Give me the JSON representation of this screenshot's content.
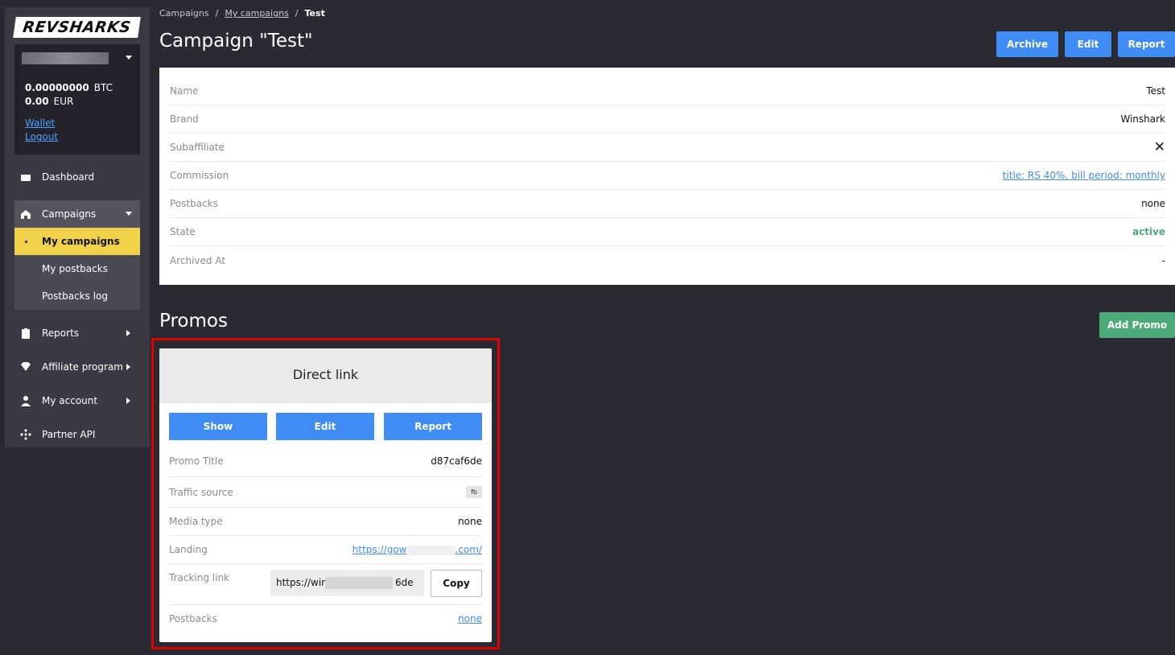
{
  "brand": {
    "logo_text": "REVSHARKS"
  },
  "balance": {
    "btc_amount": "0.00000000",
    "btc_currency": "BTC",
    "eur_amount": "0.00",
    "eur_currency": "EUR",
    "wallet_label": "Wallet",
    "logout_label": "Logout"
  },
  "sidebar": {
    "dashboard": "Dashboard",
    "campaigns": "Campaigns",
    "my_campaigns": "My campaigns",
    "my_postbacks": "My postbacks",
    "postbacks_log": "Postbacks log",
    "reports": "Reports",
    "affiliate_program": "Affiliate program",
    "my_account": "My account",
    "partner_api": "Partner API"
  },
  "breadcrumb": {
    "root": "Campaigns",
    "mid": "My campaigns",
    "sep": "/",
    "current": "Test"
  },
  "page_title": "Campaign \"Test\"",
  "header_buttons": {
    "archive": "Archive",
    "edit": "Edit",
    "report": "Report"
  },
  "campaign": {
    "rows": [
      {
        "label": "Name",
        "value": "Test"
      },
      {
        "label": "Brand",
        "value": "Winshark"
      },
      {
        "label": "Subaffiliate",
        "value": "✕"
      },
      {
        "label": "Commission",
        "value": "title: RS 40%, bill period: monthly"
      },
      {
        "label": "Postbacks",
        "value": "none"
      },
      {
        "label": "State",
        "value": "active"
      },
      {
        "label": "Archived At",
        "value": "-"
      }
    ]
  },
  "promos": {
    "title": "Promos",
    "add_button": "Add Promo",
    "card": {
      "title": "Direct link",
      "show": "Show",
      "edit": "Edit",
      "report": "Report",
      "promo_title_label": "Promo Title",
      "promo_title_value": "d87caf6de",
      "traffic_source_label": "Traffic source",
      "traffic_source_value": "fb",
      "media_type_label": "Media type",
      "media_type_value": "none",
      "landing_label": "Landing",
      "landing_prefix": "https://gow",
      "landing_suffix": ".com/",
      "tracking_label": "Tracking link",
      "tracking_prefix": "https://wins",
      "tracking_suffix": "6de",
      "copy_label": "Copy",
      "postbacks_label": "Postbacks",
      "postbacks_value": "none"
    }
  },
  "colors": {
    "primary": "#3f8cf5",
    "success": "#4caa78",
    "active_nav": "#f0d24a",
    "highlight": "#e00000",
    "background": "#2b2a33"
  }
}
